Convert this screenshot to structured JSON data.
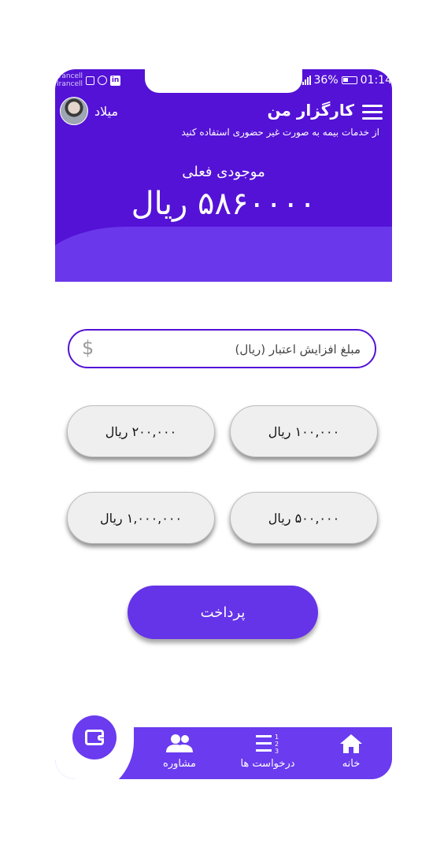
{
  "status_bar": {
    "carrier_top": "Irancell",
    "carrier_bottom": "Irancell",
    "battery": "36%",
    "time": "01:14"
  },
  "header": {
    "app_title": "کارگزار من",
    "subtitle": "از خدمات بیمه به صورت غیر حضوری استفاده کنید",
    "user_name": "میلاد"
  },
  "balance": {
    "label": "موجودی فعلی",
    "amount": "۵۸۶۰۰۰۰ ریال"
  },
  "amount_input": {
    "placeholder": "مبلغ افزایش اعتبار (ریال)",
    "value": ""
  },
  "presets": [
    {
      "label": "۱۰۰,۰۰۰ ریال"
    },
    {
      "label": "۲۰۰,۰۰۰ ریال"
    },
    {
      "label": "۵۰۰,۰۰۰ ریال"
    },
    {
      "label": "۱,۰۰۰,۰۰۰ ریال"
    }
  ],
  "pay_button": {
    "label": "پرداخت"
  },
  "bottom_nav": {
    "items": [
      {
        "label": "خانه",
        "icon": "home-icon"
      },
      {
        "label": "درخواست ها",
        "icon": "request-list-icon"
      },
      {
        "label": "مشاوره",
        "icon": "consult-people-icon"
      }
    ],
    "active_icon": "wallet-icon"
  },
  "colors": {
    "primary": "#5412d6",
    "accent": "#6a3bef",
    "button_bg": "#efefef"
  }
}
